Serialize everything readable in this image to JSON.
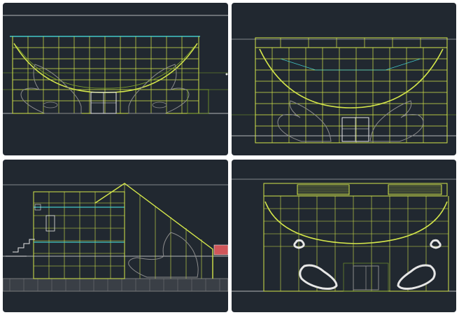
{
  "app": {
    "canvas_background": "#ffffff",
    "viewport_background": "#212830"
  },
  "colors": {
    "primary_line": "#d4e64a",
    "secondary_line": "#7fa32a",
    "cyan_line": "#43c7c7",
    "white_line": "#e6e6e6",
    "gray_line": "#8c8c8c",
    "red_hatch": "#d0575a"
  },
  "viewports": [
    {
      "id": "front-elevation",
      "label": ""
    },
    {
      "id": "rear-elevation",
      "label": ""
    },
    {
      "id": "side-section",
      "label": ""
    },
    {
      "id": "perspective-elevation",
      "label": ""
    }
  ]
}
